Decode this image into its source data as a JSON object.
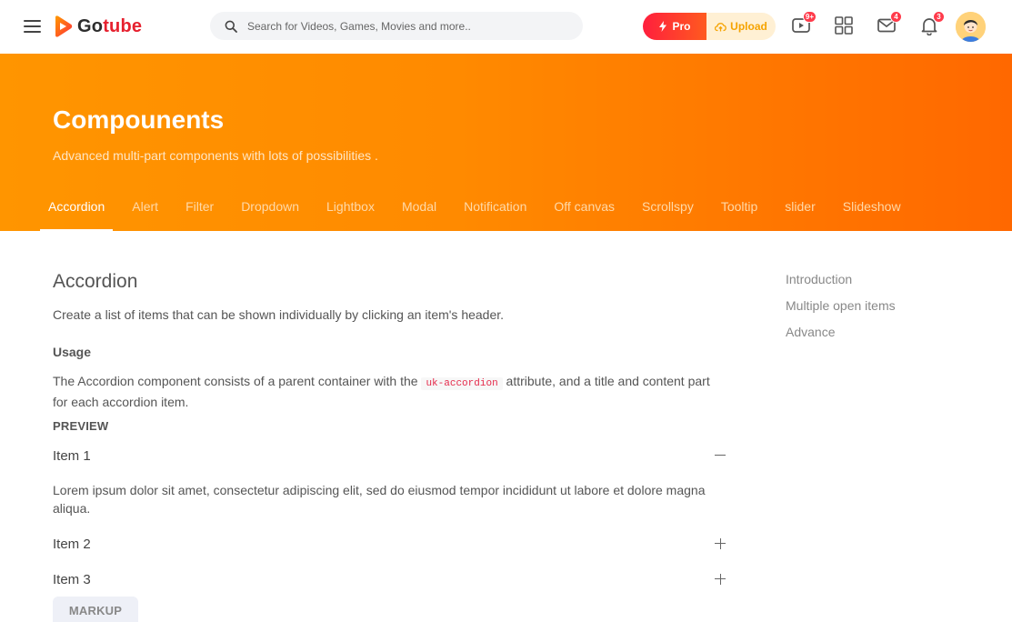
{
  "header": {
    "brand_prefix": "Go",
    "brand_suffix": "tube",
    "search_placeholder": "Search for Videos, Games, Movies and more..",
    "pro_label": "Pro",
    "upload_label": "Upload",
    "icons": [
      {
        "name": "video-icon",
        "badge": "9+"
      },
      {
        "name": "apps-grid-icon",
        "badge": ""
      },
      {
        "name": "mail-icon",
        "badge": "4"
      },
      {
        "name": "bell-icon",
        "badge": "3"
      }
    ]
  },
  "hero": {
    "title": "Compounents",
    "subtitle": "Advanced multi-part components with lots of possibilities .",
    "tabs": [
      "Accordion",
      "Alert",
      "Filter",
      "Dropdown",
      "Lightbox",
      "Modal",
      "Notification",
      "Off canvas",
      "Scrollspy",
      "Tooltip",
      "slider",
      "Slideshow"
    ],
    "active_tab": "Accordion"
  },
  "content": {
    "title": "Accordion",
    "lead": "Create a list of items that can be shown individually by clicking an item's header.",
    "usage_heading": "Usage",
    "usage_text_before": "The Accordion component consists of a parent container with the ",
    "usage_code": "uk-accordion",
    "usage_text_after": " attribute, and a title and content part for each accordion item.",
    "preview_heading": "PREVIEW",
    "items": [
      {
        "title": "Item 1",
        "open": true
      },
      {
        "title": "Item 2",
        "open": false
      },
      {
        "title": "Item 3",
        "open": false
      }
    ],
    "item_body": "Lorem ipsum dolor sit amet, consectetur adipiscing elit, sed do eiusmod tempor incididunt ut labore et dolore magna aliqua.",
    "markup_label": "MARKUP"
  },
  "rightnav": {
    "items": [
      "Introduction",
      "Multiple open items",
      "Advance"
    ]
  },
  "colors": {
    "accent": "#ff8a00",
    "brand_red": "#e6212f",
    "badge": "#ff3b4b",
    "code": "#e5294a"
  }
}
